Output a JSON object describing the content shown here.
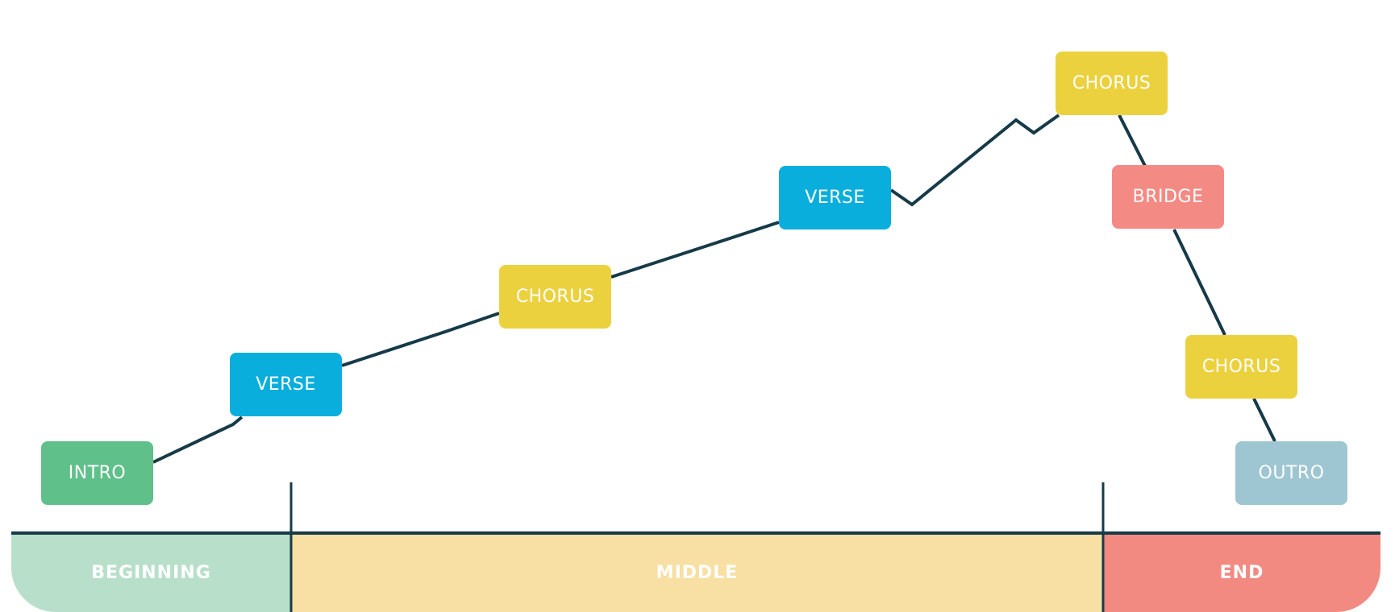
{
  "colors": {
    "line": "#163a48",
    "intro": "#5fc08a",
    "verse": "#0aaedc",
    "chorus": "#ecd13f",
    "bridge": "#f48a84",
    "outro": "#9ec6d2",
    "beginning": "#b8dfca",
    "middle": "#f8dfa3",
    "end": "#f28a82"
  },
  "sections": [
    {
      "label": "INTRO",
      "type": "intro"
    },
    {
      "label": "VERSE",
      "type": "verse"
    },
    {
      "label": "CHORUS",
      "type": "chorus"
    },
    {
      "label": "VERSE",
      "type": "verse"
    },
    {
      "label": "CHORUS",
      "type": "chorus"
    },
    {
      "label": "BRIDGE",
      "type": "bridge"
    },
    {
      "label": "CHORUS",
      "type": "chorus"
    },
    {
      "label": "OUTRO",
      "type": "outro"
    }
  ],
  "phases": [
    {
      "label": "BEGINNING"
    },
    {
      "label": "MIDDLE"
    },
    {
      "label": "END"
    }
  ]
}
